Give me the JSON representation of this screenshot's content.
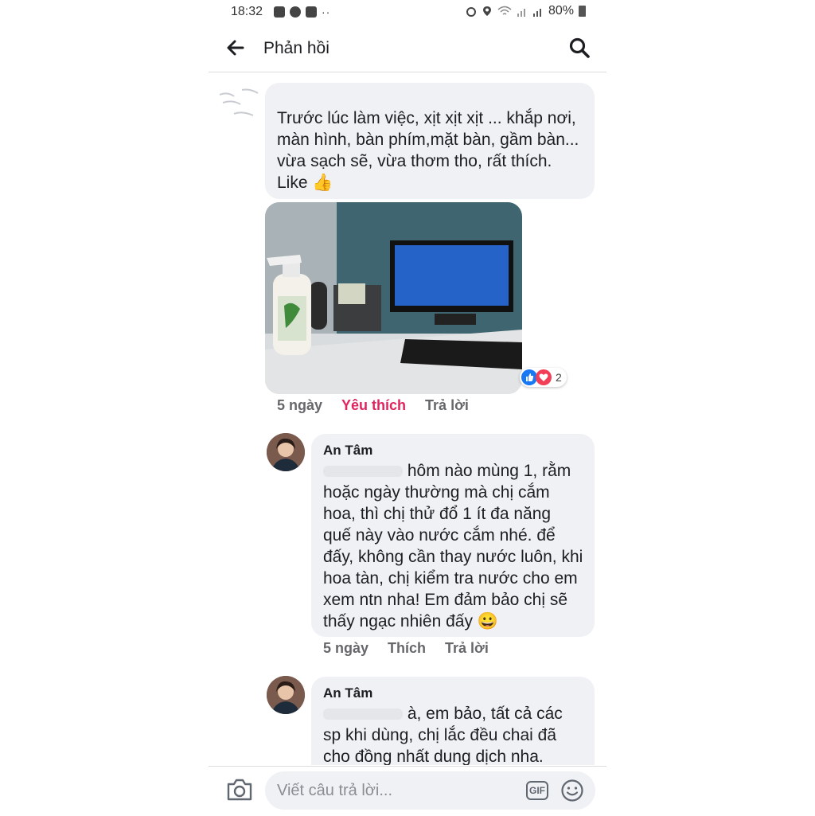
{
  "status_bar": {
    "time": "18:32",
    "dots": "··",
    "battery": "80%"
  },
  "header": {
    "title": "Phản hồi"
  },
  "comments": [
    {
      "text": "Trước lúc làm việc, xịt xịt xịt ... khắp nơi,\nmàn hình, bàn phím,mặt bàn, gầm bàn...\nvừa sạch sẽ, vừa thơm tho, rất thích.\nLike 👍",
      "reactions_count": "2",
      "actions": {
        "time": "5 ngày",
        "like": "Yêu thích",
        "reply": "Trả lời"
      }
    }
  ],
  "replies": [
    {
      "name": "An Tâm",
      "text_line1": " hôm nào mùng 1, rằm",
      "text_rest": "hoặc ngày thường mà chị cắm\nhoa, thì chị thử đổ 1 ít đa năng\nquế này vào nước cắm nhé. để\nđấy, không cần thay nước luôn, khi\nhoa tàn, chị kiểm tra nước cho em\nxem ntn nha! Em đảm bảo chị sẽ\nthấy ngạc nhiên đấy 😀",
      "actions": {
        "time": "5 ngày",
        "like": "Thích",
        "reply": "Trả lời"
      }
    },
    {
      "name": "An Tâm",
      "text_line1": " à, em bảo, tất cả các",
      "text_rest": "sp khi dùng, chị lắc đều chai đã\ncho đồng nhất dung dịch nha."
    }
  ],
  "composer": {
    "placeholder": "Viết câu trả lời...",
    "gif_label": "GIF"
  },
  "colors": {
    "bubble": "#eff1f5",
    "liked": "#e0245e",
    "muted": "#65676b",
    "like_blue": "#1877f2",
    "love_red": "#f33e58"
  }
}
